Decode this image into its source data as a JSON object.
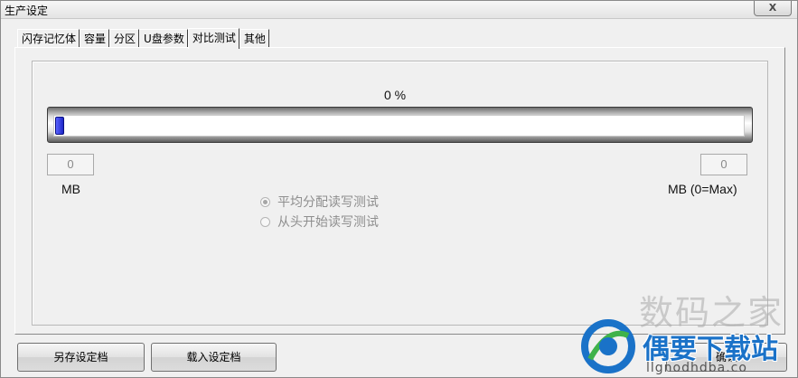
{
  "window": {
    "title": "生产设定",
    "close_label": "X"
  },
  "tabs": [
    "闪存记忆体",
    "容量",
    "分区",
    "U盘参数",
    "对比测试",
    "其他"
  ],
  "active_tab": "对比测试",
  "test": {
    "percent_label": "0 %",
    "progress_fraction": 0,
    "left_value": "0",
    "left_unit": "MB",
    "right_value": "0",
    "right_unit": "MB (0=Max)",
    "options": [
      {
        "label": "平均分配读写测试",
        "checked": true
      },
      {
        "label": "从头开始读写测试",
        "checked": false
      }
    ]
  },
  "buttons": {
    "save": "另存设定档",
    "load": "载入设定档",
    "ok": "确认"
  },
  "watermark": {
    "top_text": "数码之家",
    "main_text": "偶要下载站",
    "url_text": "llgnodhdba.co"
  },
  "colors": {
    "progress_knob": "#2a33d8",
    "watermark_blue": "#1a72c8"
  }
}
